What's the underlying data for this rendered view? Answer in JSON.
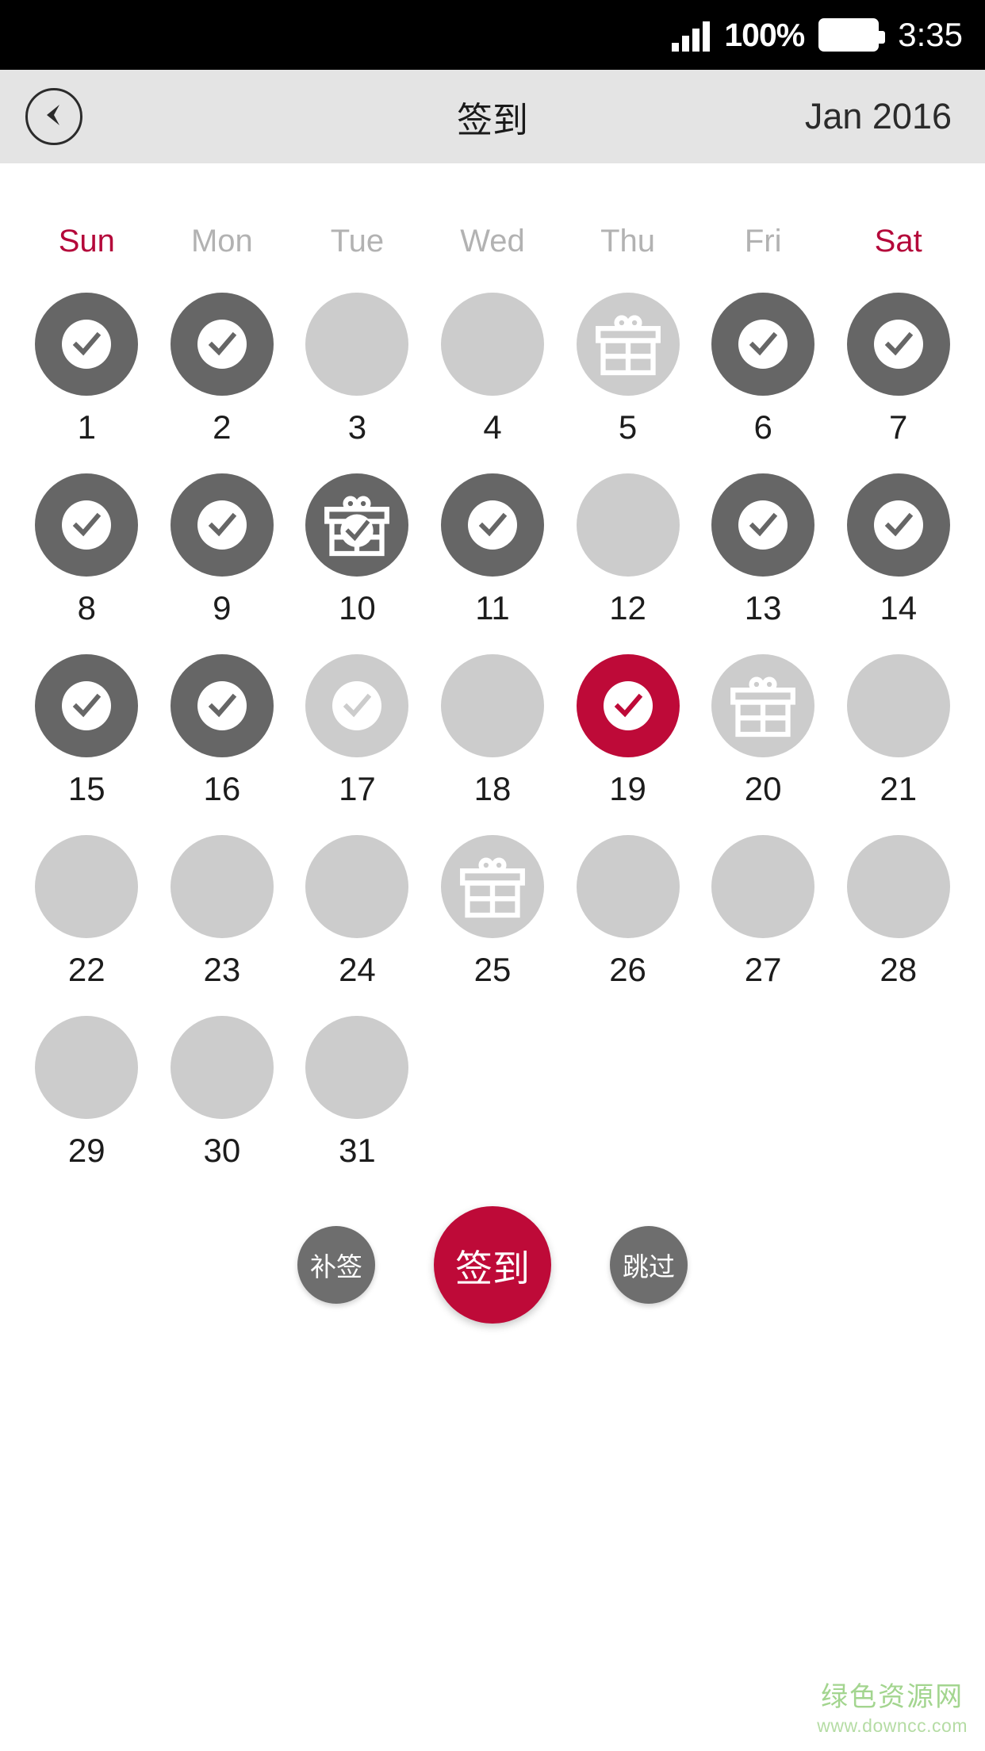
{
  "status_bar": {
    "signal_icon": "signal-bars-icon",
    "battery_percent": "100%",
    "battery_icon": "battery-full-icon",
    "time": "3:35"
  },
  "nav_bar": {
    "back_icon": "back-arrow-icon",
    "title": "签到",
    "month_label": "Jan 2016"
  },
  "calendar": {
    "weekdays": [
      {
        "label": "Sun",
        "accent": true
      },
      {
        "label": "Mon",
        "accent": false
      },
      {
        "label": "Tue",
        "accent": false
      },
      {
        "label": "Wed",
        "accent": false
      },
      {
        "label": "Thu",
        "accent": false
      },
      {
        "label": "Fri",
        "accent": false
      },
      {
        "label": "Sat",
        "accent": false
      }
    ],
    "weekdays_accent_label": "Sat",
    "weeks": [
      [
        {
          "day": "1",
          "state": "checked"
        },
        {
          "day": "2",
          "state": "checked"
        },
        {
          "day": "3",
          "state": "plain"
        },
        {
          "day": "4",
          "state": "plain"
        },
        {
          "day": "5",
          "state": "gift-light"
        },
        {
          "day": "6",
          "state": "checked"
        },
        {
          "day": "7",
          "state": "checked"
        }
      ],
      [
        {
          "day": "8",
          "state": "checked"
        },
        {
          "day": "9",
          "state": "checked"
        },
        {
          "day": "10",
          "state": "gift-dark-checked"
        },
        {
          "day": "11",
          "state": "checked"
        },
        {
          "day": "12",
          "state": "plain"
        },
        {
          "day": "13",
          "state": "checked"
        },
        {
          "day": "14",
          "state": "checked"
        }
      ],
      [
        {
          "day": "15",
          "state": "checked"
        },
        {
          "day": "16",
          "state": "checked"
        },
        {
          "day": "17",
          "state": "faded-check"
        },
        {
          "day": "18",
          "state": "plain"
        },
        {
          "day": "19",
          "state": "today"
        },
        {
          "day": "20",
          "state": "gift-light"
        },
        {
          "day": "21",
          "state": "plain"
        }
      ],
      [
        {
          "day": "22",
          "state": "plain"
        },
        {
          "day": "23",
          "state": "plain"
        },
        {
          "day": "24",
          "state": "plain"
        },
        {
          "day": "25",
          "state": "gift-light"
        },
        {
          "day": "26",
          "state": "plain"
        },
        {
          "day": "27",
          "state": "plain"
        },
        {
          "day": "28",
          "state": "plain"
        }
      ],
      [
        {
          "day": "29",
          "state": "plain"
        },
        {
          "day": "30",
          "state": "plain"
        },
        {
          "day": "31",
          "state": "plain"
        },
        {
          "day": "",
          "state": "empty"
        },
        {
          "day": "",
          "state": "empty"
        },
        {
          "day": "",
          "state": "empty"
        },
        {
          "day": "",
          "state": "empty"
        }
      ]
    ]
  },
  "actions": {
    "makeup_label": "补签",
    "signin_label": "签到",
    "skip_label": "跳过"
  },
  "watermark": {
    "site_name": "绿色资源网",
    "url": "www.downcc.com"
  },
  "colors": {
    "accent": "#be0a38",
    "accent_text": "#b4083a",
    "checked_circle": "#666666",
    "plain_circle": "#cccccc",
    "navbar_bg": "#e4e4e4",
    "statusbar_bg": "#000000",
    "day_number": "#1c1c1c",
    "weekday_gray": "#b2b2b2",
    "watermark_green": "#a3d58f"
  }
}
